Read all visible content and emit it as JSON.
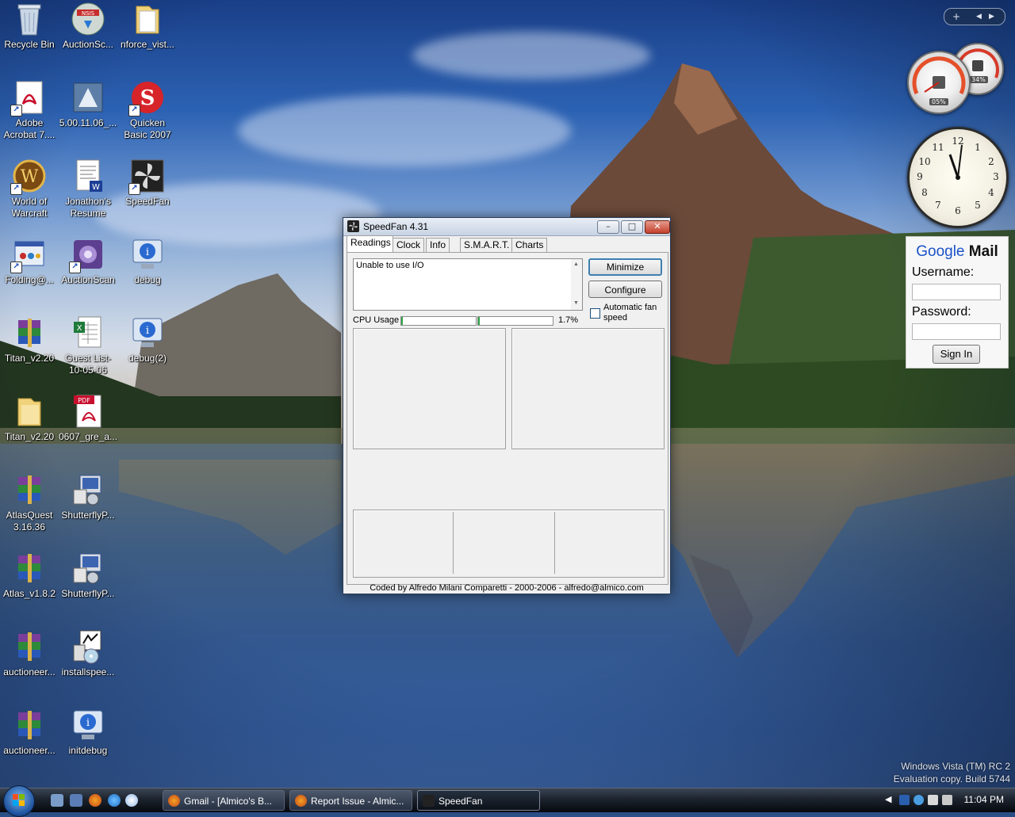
{
  "desktop": {
    "icons": [
      {
        "label": "Recycle Bin"
      },
      {
        "label": "AuctionSc..."
      },
      {
        "label": "nforce_vist..."
      },
      {
        "label": "Adobe Acrobat 7...."
      },
      {
        "label": "5.00.11.06_..."
      },
      {
        "label": "Quicken Basic 2007"
      },
      {
        "label": "World of Warcraft"
      },
      {
        "label": "Jonathon's Resume"
      },
      {
        "label": "SpeedFan"
      },
      {
        "label": "Folding@..."
      },
      {
        "label": "AuctionScan"
      },
      {
        "label": "debug"
      },
      {
        "label": "Titan_v2.20"
      },
      {
        "label": "Guest List-10-05-06"
      },
      {
        "label": "debug(2)"
      },
      {
        "label": "Titan_v2.20"
      },
      {
        "label": "0607_gre_a..."
      },
      {
        "label": "AtlasQuest 3.16.36"
      },
      {
        "label": "ShutterflyP..."
      },
      {
        "label": "Atlas_v1.8.2"
      },
      {
        "label": "ShutterflyP..."
      },
      {
        "label": "auctioneer..."
      },
      {
        "label": "installspee..."
      },
      {
        "label": "auctioneer..."
      },
      {
        "label": "initdebug"
      }
    ],
    "watermark": {
      "line1": "Windows Vista (TM) RC 2",
      "line2": "Evaluation copy. Build 5744"
    }
  },
  "speedfan": {
    "title": "SpeedFan 4.31",
    "controls": {
      "minimize": "–",
      "maximize": "□",
      "close": "✕"
    },
    "tabs": [
      {
        "label": "Readings"
      },
      {
        "label": "Clock"
      },
      {
        "label": "Info"
      },
      {
        "label": "S.M.A.R.T."
      },
      {
        "label": "Charts"
      }
    ],
    "active_tab": "Readings",
    "log_text": "Unable to use I/O",
    "buttons": {
      "minimize": "Minimize",
      "configure": "Configure"
    },
    "auto_fan_label": "Automatic fan speed",
    "auto_fan_checked": false,
    "cpu_label": "CPU Usage",
    "cpu_percent": "1.7%",
    "cpu_usage_fraction": 0.017,
    "status": "Coded by Alfredo Milani Comparetti - 2000-2006 - alfredo@almico.com"
  },
  "sidebar": {
    "gauge_cpu": "05%",
    "gauge_mem": "34%",
    "gmail": {
      "logo_google": "Google",
      "logo_mail": "Mail",
      "username_label": "Username:",
      "username_value": "",
      "password_label": "Password:",
      "password_value": "",
      "signin_label": "Sign In"
    }
  },
  "taskbar": {
    "buttons": [
      {
        "label": "Gmail - [Almico's B..."
      },
      {
        "label": "Report Issue - Almic..."
      },
      {
        "label": "SpeedFan"
      }
    ],
    "clock": "11:04 PM"
  }
}
